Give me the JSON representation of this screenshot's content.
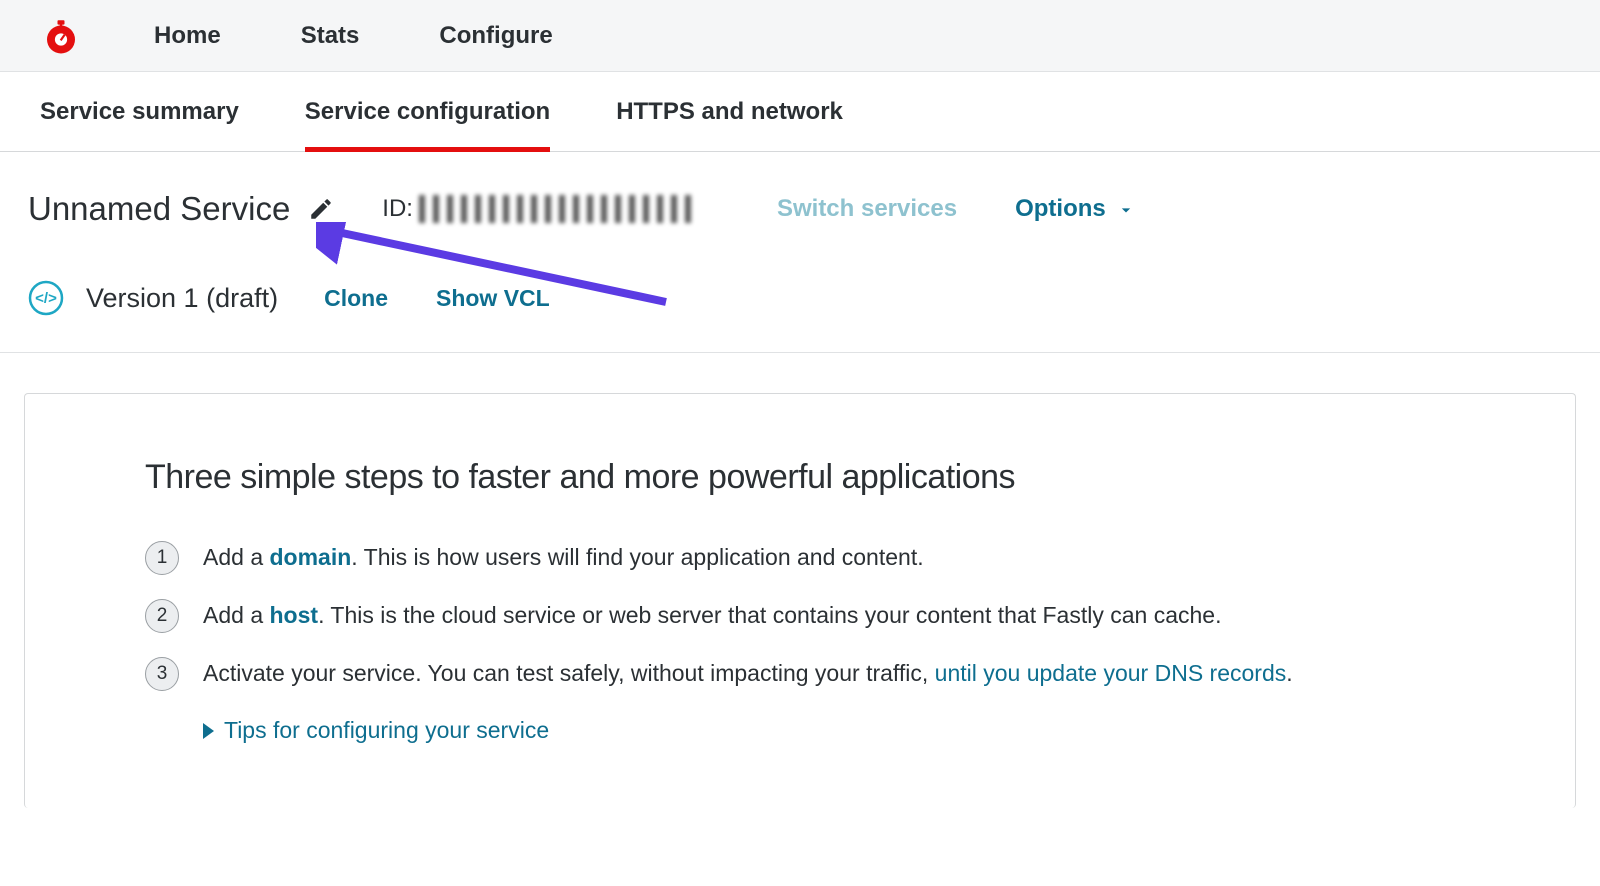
{
  "topnav": {
    "items": [
      {
        "label": "Home"
      },
      {
        "label": "Stats"
      },
      {
        "label": "Configure"
      }
    ]
  },
  "subnav": {
    "tabs": [
      {
        "label": "Service summary"
      },
      {
        "label": "Service configuration"
      },
      {
        "label": "HTTPS and network"
      }
    ]
  },
  "service": {
    "title": "Unnamed Service",
    "id_label": "ID:",
    "switch_label": "Switch services",
    "options_label": "Options"
  },
  "version": {
    "label": "Version 1 (draft)",
    "clone_label": "Clone",
    "show_vcl_label": "Show VCL"
  },
  "content": {
    "heading": "Three simple steps to faster and more powerful applications",
    "steps": [
      {
        "num": "1",
        "prefix": "Add a ",
        "link": "domain",
        "suffix": ". This is how users will find your application and content."
      },
      {
        "num": "2",
        "prefix": "Add a ",
        "link": "host",
        "suffix": ". This is the cloud service or web server that contains your content that Fastly can cache."
      },
      {
        "num": "3",
        "prefix": "Activate your service. You can test safely, without impacting your traffic, ",
        "link": "until you update your DNS records",
        "suffix": "."
      }
    ],
    "tips_label": "Tips for configuring your service"
  },
  "colors": {
    "accent": "#0e6e8f",
    "danger": "#e40f0f",
    "annotation": "#5b3be3"
  }
}
